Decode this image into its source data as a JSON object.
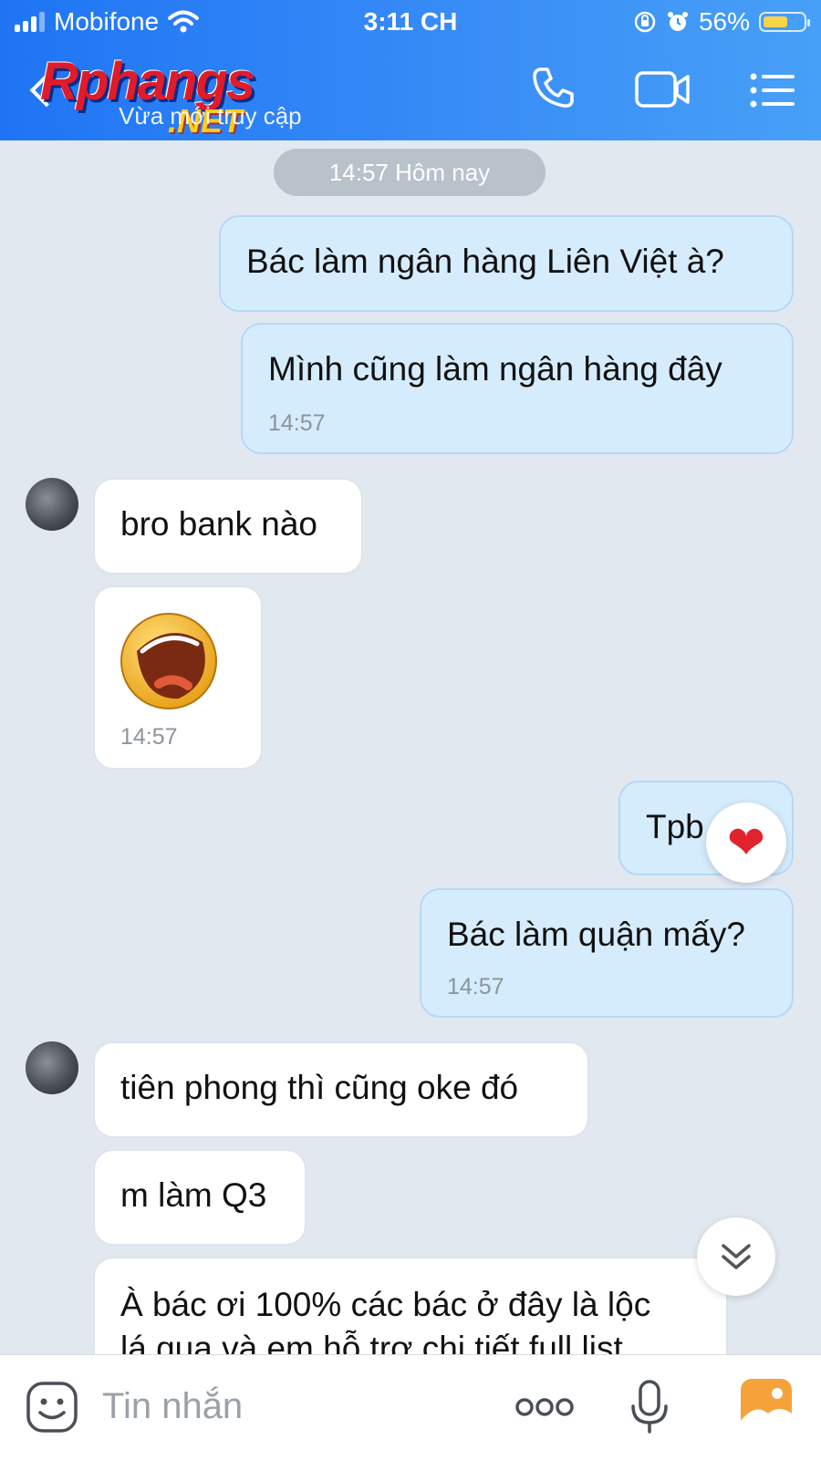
{
  "status_bar": {
    "carrier": "Mobifone",
    "time": "3:11 CH",
    "battery": "56%"
  },
  "header": {
    "logo_text": "Rphangs",
    "logo_suffix": ".NET",
    "subtitle": "Vừa mới truy cập"
  },
  "chat": {
    "date_divider": "14:57 Hôm nay",
    "messages": [
      {
        "dir": "out",
        "text": "Bác làm ngân hàng Liên Việt à?"
      },
      {
        "dir": "out",
        "text": "Mình cũng làm ngân hàng đây",
        "time": "14:57"
      },
      {
        "dir": "in",
        "text": "bro bank nào"
      },
      {
        "dir": "in",
        "sticker": "laughing-face",
        "time": "14:57"
      },
      {
        "dir": "out",
        "text": "Tpb",
        "reaction": "❤"
      },
      {
        "dir": "out",
        "text": "Bác làm quận mấy?",
        "time": "14:57"
      },
      {
        "dir": "in",
        "text": "tiên phong thì cũng oke đó"
      },
      {
        "dir": "in",
        "text": "m làm Q3"
      },
      {
        "dir": "in",
        "text_lines": [
          "À bác ơi 100% các bác ở đây là lộc",
          "lá qua và em hỗ trợ chi tiết full list"
        ]
      }
    ]
  },
  "composer": {
    "placeholder": "Tin nhắn"
  },
  "colors": {
    "header": "#2f86f6",
    "outgoing": "#d5ecfd",
    "incoming": "#ffffff",
    "background": "#e2e8f0"
  },
  "icons": [
    "signal-icon",
    "wifi-icon",
    "rotation-lock-icon",
    "alarm-icon",
    "battery-icon",
    "back-icon",
    "phone-icon",
    "video-icon",
    "menu-icon",
    "emoji-icon",
    "more-icon",
    "mic-icon",
    "image-icon",
    "chevron-down-icon",
    "heart-icon"
  ]
}
